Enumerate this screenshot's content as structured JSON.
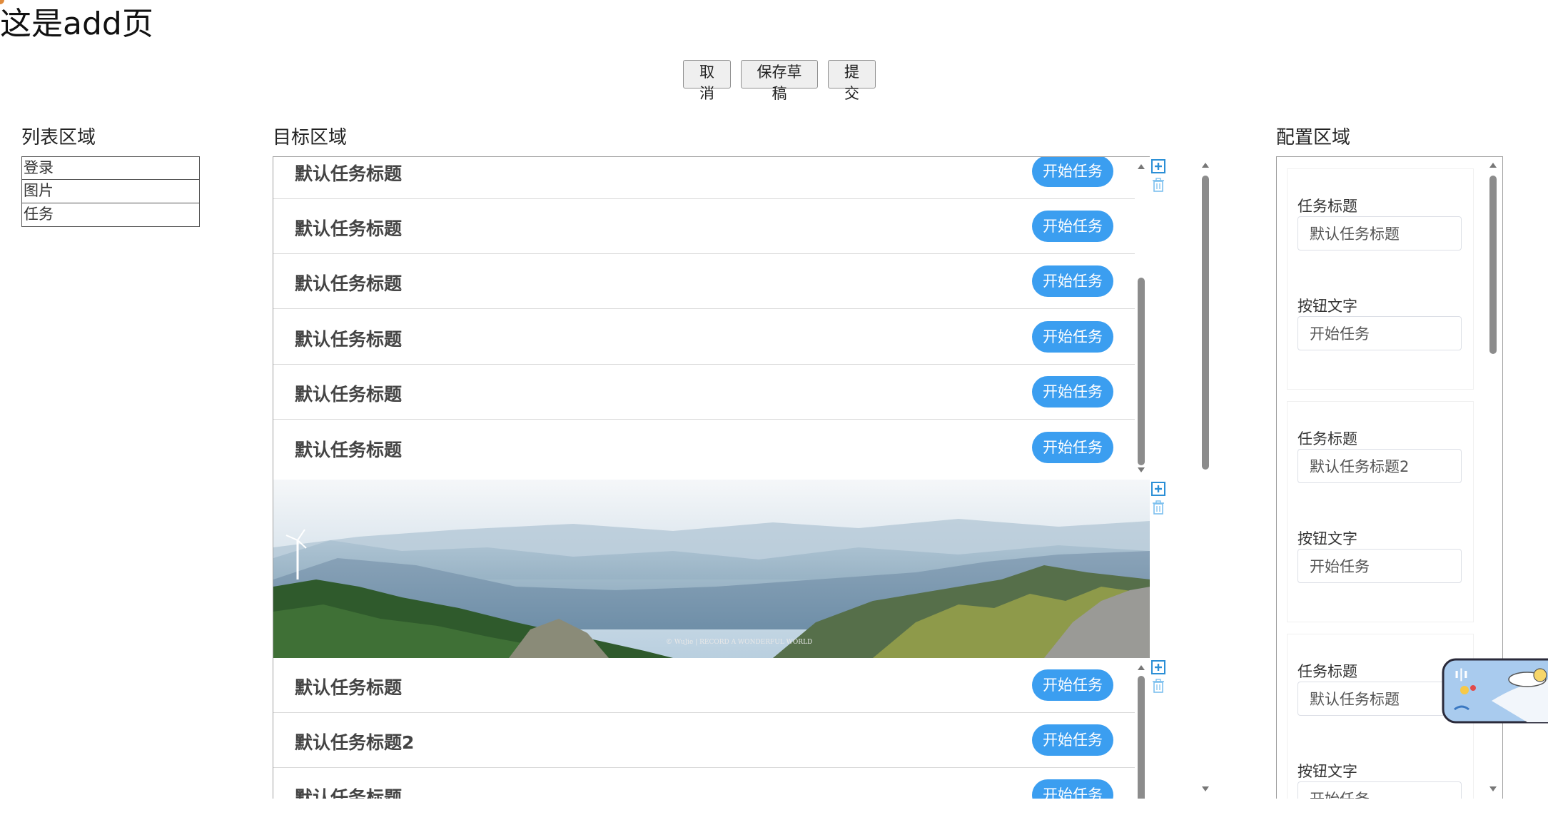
{
  "header": {
    "title": "这是add页"
  },
  "toolbar": {
    "cancel_label": "取消",
    "save_draft_label": "保存草稿",
    "submit_label": "提交"
  },
  "list_area": {
    "title": "列表区域",
    "items": [
      "登录",
      "图片",
      "任务"
    ]
  },
  "target_area": {
    "title": "目标区域",
    "task_list_1": [
      {
        "title": "默认任务标题",
        "button": "开始任务"
      },
      {
        "title": "默认任务标题",
        "button": "开始任务"
      },
      {
        "title": "默认任务标题",
        "button": "开始任务"
      },
      {
        "title": "默认任务标题",
        "button": "开始任务"
      },
      {
        "title": "默认任务标题",
        "button": "开始任务"
      },
      {
        "title": "默认任务标题",
        "button": "开始任务"
      }
    ],
    "image_watermark": "© WuJie | RECORD A WONDERFUL WORLD",
    "task_list_2": [
      {
        "title": "默认任务标题",
        "button": "开始任务"
      },
      {
        "title": "默认任务标题2",
        "button": "开始任务"
      },
      {
        "title": "默认任务标题",
        "button": "开始任务"
      }
    ]
  },
  "config_area": {
    "title": "配置区域",
    "cards": [
      {
        "title_label": "任务标题",
        "title_value": "默认任务标题",
        "button_label": "按钮文字",
        "button_value": "开始任务"
      },
      {
        "title_label": "任务标题",
        "title_value": "默认任务标题2",
        "button_label": "按钮文字",
        "button_value": "开始任务"
      },
      {
        "title_label": "任务标题",
        "title_value": "默认任务标题",
        "button_label": "按钮文字",
        "button_value": "开始任务"
      }
    ]
  },
  "icons": {
    "add": "plus-square-icon",
    "delete": "trash-icon"
  },
  "colors": {
    "accent": "#3b9ef0",
    "icon": "#2b8fd6"
  }
}
